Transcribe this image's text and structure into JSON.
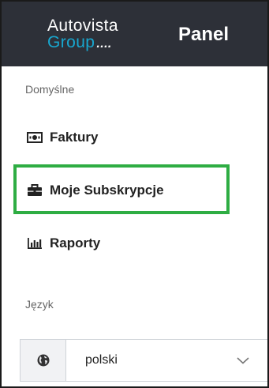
{
  "header": {
    "logo_top": "Autovista",
    "logo_bottom": "Group",
    "logo_dots": "....",
    "title": "Panel",
    "colors": {
      "background": "#2d3038",
      "logo_accent": "#18a7cf"
    }
  },
  "sidebar": {
    "section_label": "Domyślne",
    "items": [
      {
        "label": "Faktury",
        "icon": "money-bill-icon"
      },
      {
        "label": "Moje Subskrypcje",
        "icon": "briefcase-icon",
        "highlighted": true
      },
      {
        "label": "Raporty",
        "icon": "bar-chart-icon"
      }
    ],
    "highlight_color": "#2ead43"
  },
  "language": {
    "label": "Język",
    "icon": "globe-icon",
    "selected": "polski",
    "dropdown_icon": "chevron-down-icon"
  }
}
